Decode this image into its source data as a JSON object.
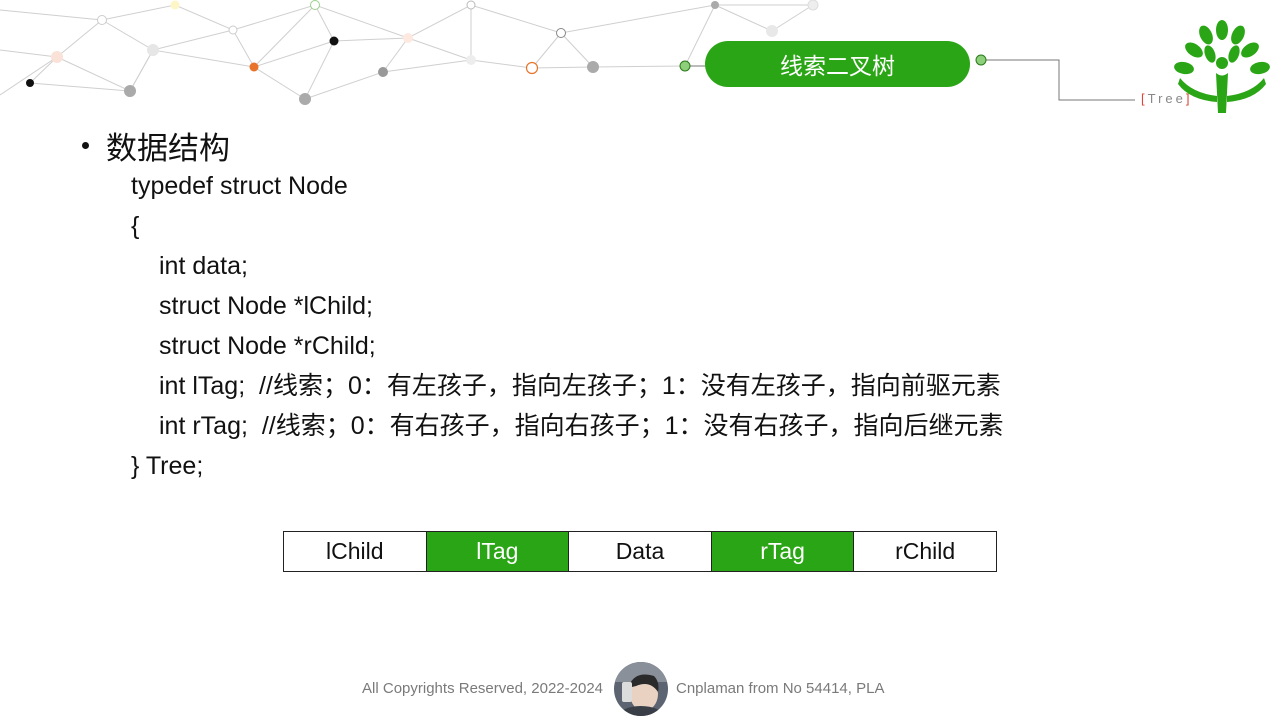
{
  "header": {
    "title": "线索二叉树",
    "tag_open": "[",
    "tag_text": "Tree",
    "tag_close": "]",
    "accent_color": "#2aa515"
  },
  "content": {
    "heading": "数据结构",
    "code_lines": [
      "typedef struct Node",
      "{",
      "int data;",
      "struct Node *lChild;",
      "struct Node *rChild;",
      "int lTag;  //线索；0：有左孩子，指向左孩子；1：没有左孩子，指向前驱元素",
      "int rTag;  //线索；0：有右孩子，指向右孩子；1：没有右孩子，指向后继元素",
      "} Tree;"
    ]
  },
  "node_fields": [
    "lChild",
    "lTag",
    "Data",
    "rTag",
    "rChild"
  ],
  "footer": {
    "copyright": "All Copyrights Reserved, 2022-2024",
    "author": "Cnplaman from No 54414, PLA"
  }
}
